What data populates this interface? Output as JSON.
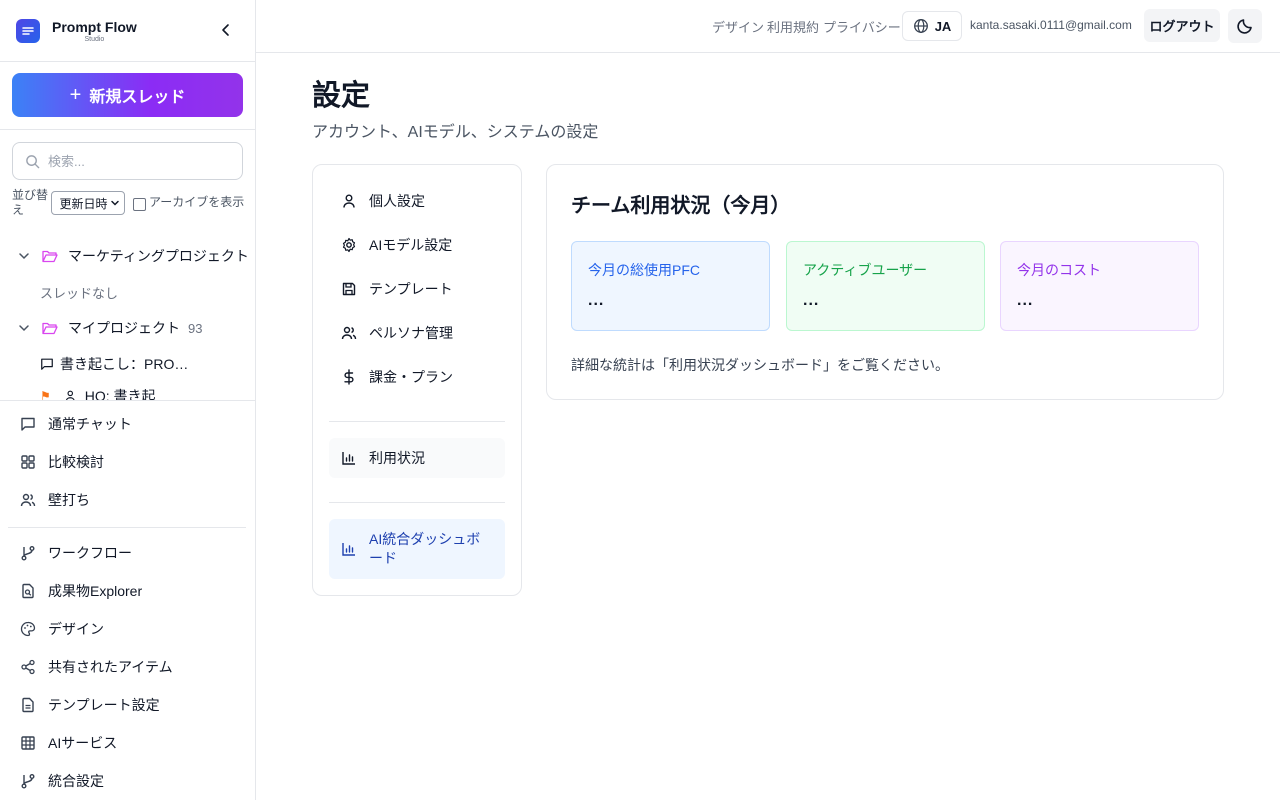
{
  "brand": {
    "name": "Prompt Flow",
    "sub": "Studio"
  },
  "sidebar": {
    "new_thread_label": "新規スレッド",
    "search_placeholder": "検索...",
    "sort_label": "並び替え",
    "sort_value": "更新日時",
    "archive_label": "アーカイブを表示",
    "tree": {
      "project1": {
        "name": "マーケティングプロジェクト",
        "count": "("
      },
      "project1_empty": "スレッドなし",
      "project2": {
        "name": "マイプロジェクト",
        "count": "93"
      },
      "thread1": "書き起こし：PRO…",
      "thread2": "HO: 書き起"
    },
    "nav_primary": [
      {
        "label": "通常チャット",
        "icon": "message-square-icon"
      },
      {
        "label": "比較検討",
        "icon": "grid-icon"
      },
      {
        "label": "壁打ち",
        "icon": "users-icon"
      }
    ],
    "nav_secondary": [
      {
        "label": "ワークフロー",
        "icon": "git-branch-icon"
      },
      {
        "label": "成果物Explorer",
        "icon": "file-search-icon"
      },
      {
        "label": "デザイン",
        "icon": "palette-icon"
      },
      {
        "label": "共有されたアイテム",
        "icon": "share-icon"
      },
      {
        "label": "テンプレート設定",
        "icon": "file-text-icon"
      },
      {
        "label": "AIサービス",
        "icon": "table-grid-icon"
      },
      {
        "label": "統合設定",
        "icon": "git-merge-icon"
      }
    ]
  },
  "header": {
    "links": [
      "デザイン",
      "利用規約",
      "プライバシー"
    ],
    "lang": "JA",
    "email": "kanta.sasaki.0111@gmail.com",
    "logout": "ログアウト"
  },
  "main": {
    "title": "設定",
    "subtitle": "アカウント、AIモデル、システムの設定",
    "settings_nav": [
      {
        "label": "個人設定",
        "icon": "user-icon"
      },
      {
        "label": "AIモデル設定",
        "icon": "gear-icon"
      },
      {
        "label": "テンプレート",
        "icon": "save-icon"
      },
      {
        "label": "ペルソナ管理",
        "icon": "users-icon"
      },
      {
        "label": "課金・プラン",
        "icon": "dollar-icon"
      }
    ],
    "usage_nav": "利用状況",
    "dashboard_nav_line1": "AI統合ダッシュボ",
    "dashboard_nav_line2": "ード",
    "usage": {
      "title": "チーム利用状況（今月）",
      "stats": [
        {
          "label": "今月の総使用PFC",
          "value": "..."
        },
        {
          "label": "アクティブユーザー",
          "value": "..."
        },
        {
          "label": "今月のコスト",
          "value": "..."
        }
      ],
      "note": "詳細な統計は「利用状況ダッシュボード」をご覧ください。"
    }
  },
  "colors": {
    "accent_start": "#3b82f6",
    "accent_end": "#9333ea",
    "blue": "#2563eb",
    "green": "#16a34a",
    "purple": "#9333ea"
  }
}
